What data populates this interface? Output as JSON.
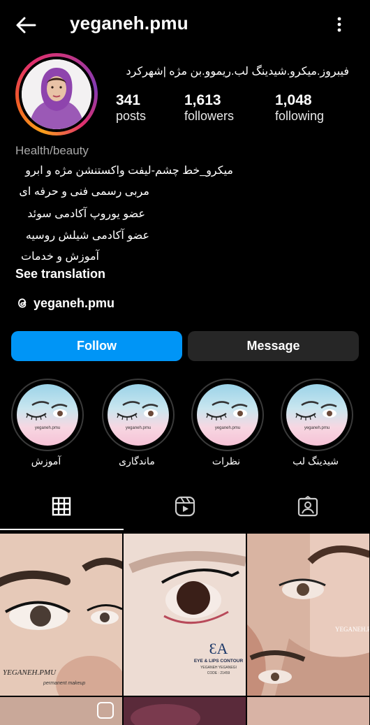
{
  "header": {
    "username": "yeganeh.pmu",
    "back_icon": "arrow-left-icon",
    "menu_icon": "more-vertical-icon"
  },
  "profile": {
    "headline": "فیبروز.میکرو.شیدینگ لب.ریموو.بن مژه |شهرکرد",
    "stats": [
      {
        "value": "341",
        "label": "posts"
      },
      {
        "value": "1,613",
        "label": "followers"
      },
      {
        "value": "1,048",
        "label": "following"
      }
    ],
    "category": "Health/beauty",
    "bio": [
      "میکرو_خط چشم-لیفت واکستنشن مژه و ابرو",
      "مربی رسمی فنی و حرفه ای",
      "عضو  یوروپ آکادمی سوئد",
      "عضو  آکادمی شیلش روسیه",
      "آموزش و خدمات"
    ],
    "see_translation": "See translation",
    "threads_handle": "yeganeh.pmu"
  },
  "actions": {
    "follow": "Follow",
    "message": "Message"
  },
  "highlights": [
    {
      "label": "آموزش",
      "caption": "yeganeh.pmu"
    },
    {
      "label": "ماندگاری",
      "caption": "yeganeh.pmu"
    },
    {
      "label": "نظرات",
      "caption": "yeganeh.pmu"
    },
    {
      "label": "شیدینگ لب",
      "caption": "yeganeh.pmu"
    }
  ],
  "tabs": [
    "grid-icon",
    "reels-icon",
    "tagged-icon"
  ],
  "posts": [
    {
      "watermark": "YEGANEH.PMU",
      "subtitle": "permanent makeup"
    },
    {
      "brand": "EYE & LIPS CONTOUR",
      "name": "YEGANEH YEGANEGI",
      "code": "CODE : 21459"
    },
    {
      "watermark": "YEGANEH.PMU"
    }
  ],
  "colors": {
    "background": "#000000",
    "follow_button": "#0095f6",
    "message_button": "#262626",
    "muted_text": "#a8a8a8"
  }
}
